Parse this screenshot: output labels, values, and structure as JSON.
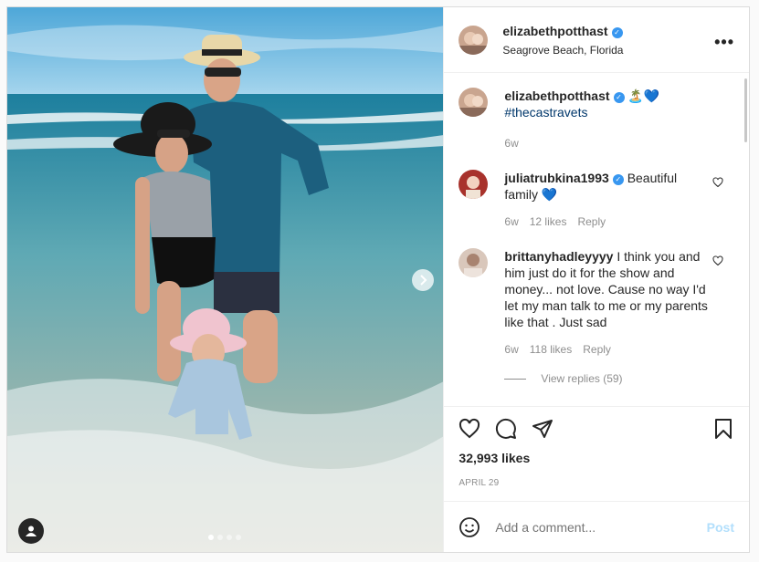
{
  "post": {
    "username": "elizabethpotthast",
    "location": "Seagrove Beach, Florida",
    "more_label": "•••"
  },
  "comments": [
    {
      "username": "elizabethpotthast",
      "text": "🏝️💙",
      "hashtag": "#thecastravets",
      "age": "6w"
    },
    {
      "username": "juliatrubkina1993",
      "text": "Beautiful family 💙",
      "age": "6w",
      "likes": "12 likes",
      "reply": "Reply"
    },
    {
      "username": "brittanyhadleyyyy",
      "text": "I think you and him just do it for the show and money... not love. Cause no way I'd let my man talk to me or my parents like that . Just sad",
      "age": "6w",
      "likes": "118 likes",
      "reply": "Reply",
      "view_replies": "View replies (59)"
    }
  ],
  "actions": {
    "likes_count": "32,993 likes",
    "date": "APRIL 29"
  },
  "add_comment": {
    "placeholder": "Add a comment...",
    "post_label": "Post"
  },
  "carousel": {
    "total": 4,
    "current": 1
  },
  "colors": {
    "verified": "#3897f0",
    "link": "#00376b",
    "post_disabled": "#b2dffc"
  },
  "icons": [
    "chevron-right-icon",
    "user-tag-icon",
    "heart-icon",
    "comment-icon",
    "share-icon",
    "bookmark-icon",
    "emoji-icon",
    "more-icon",
    "verified-icon"
  ]
}
